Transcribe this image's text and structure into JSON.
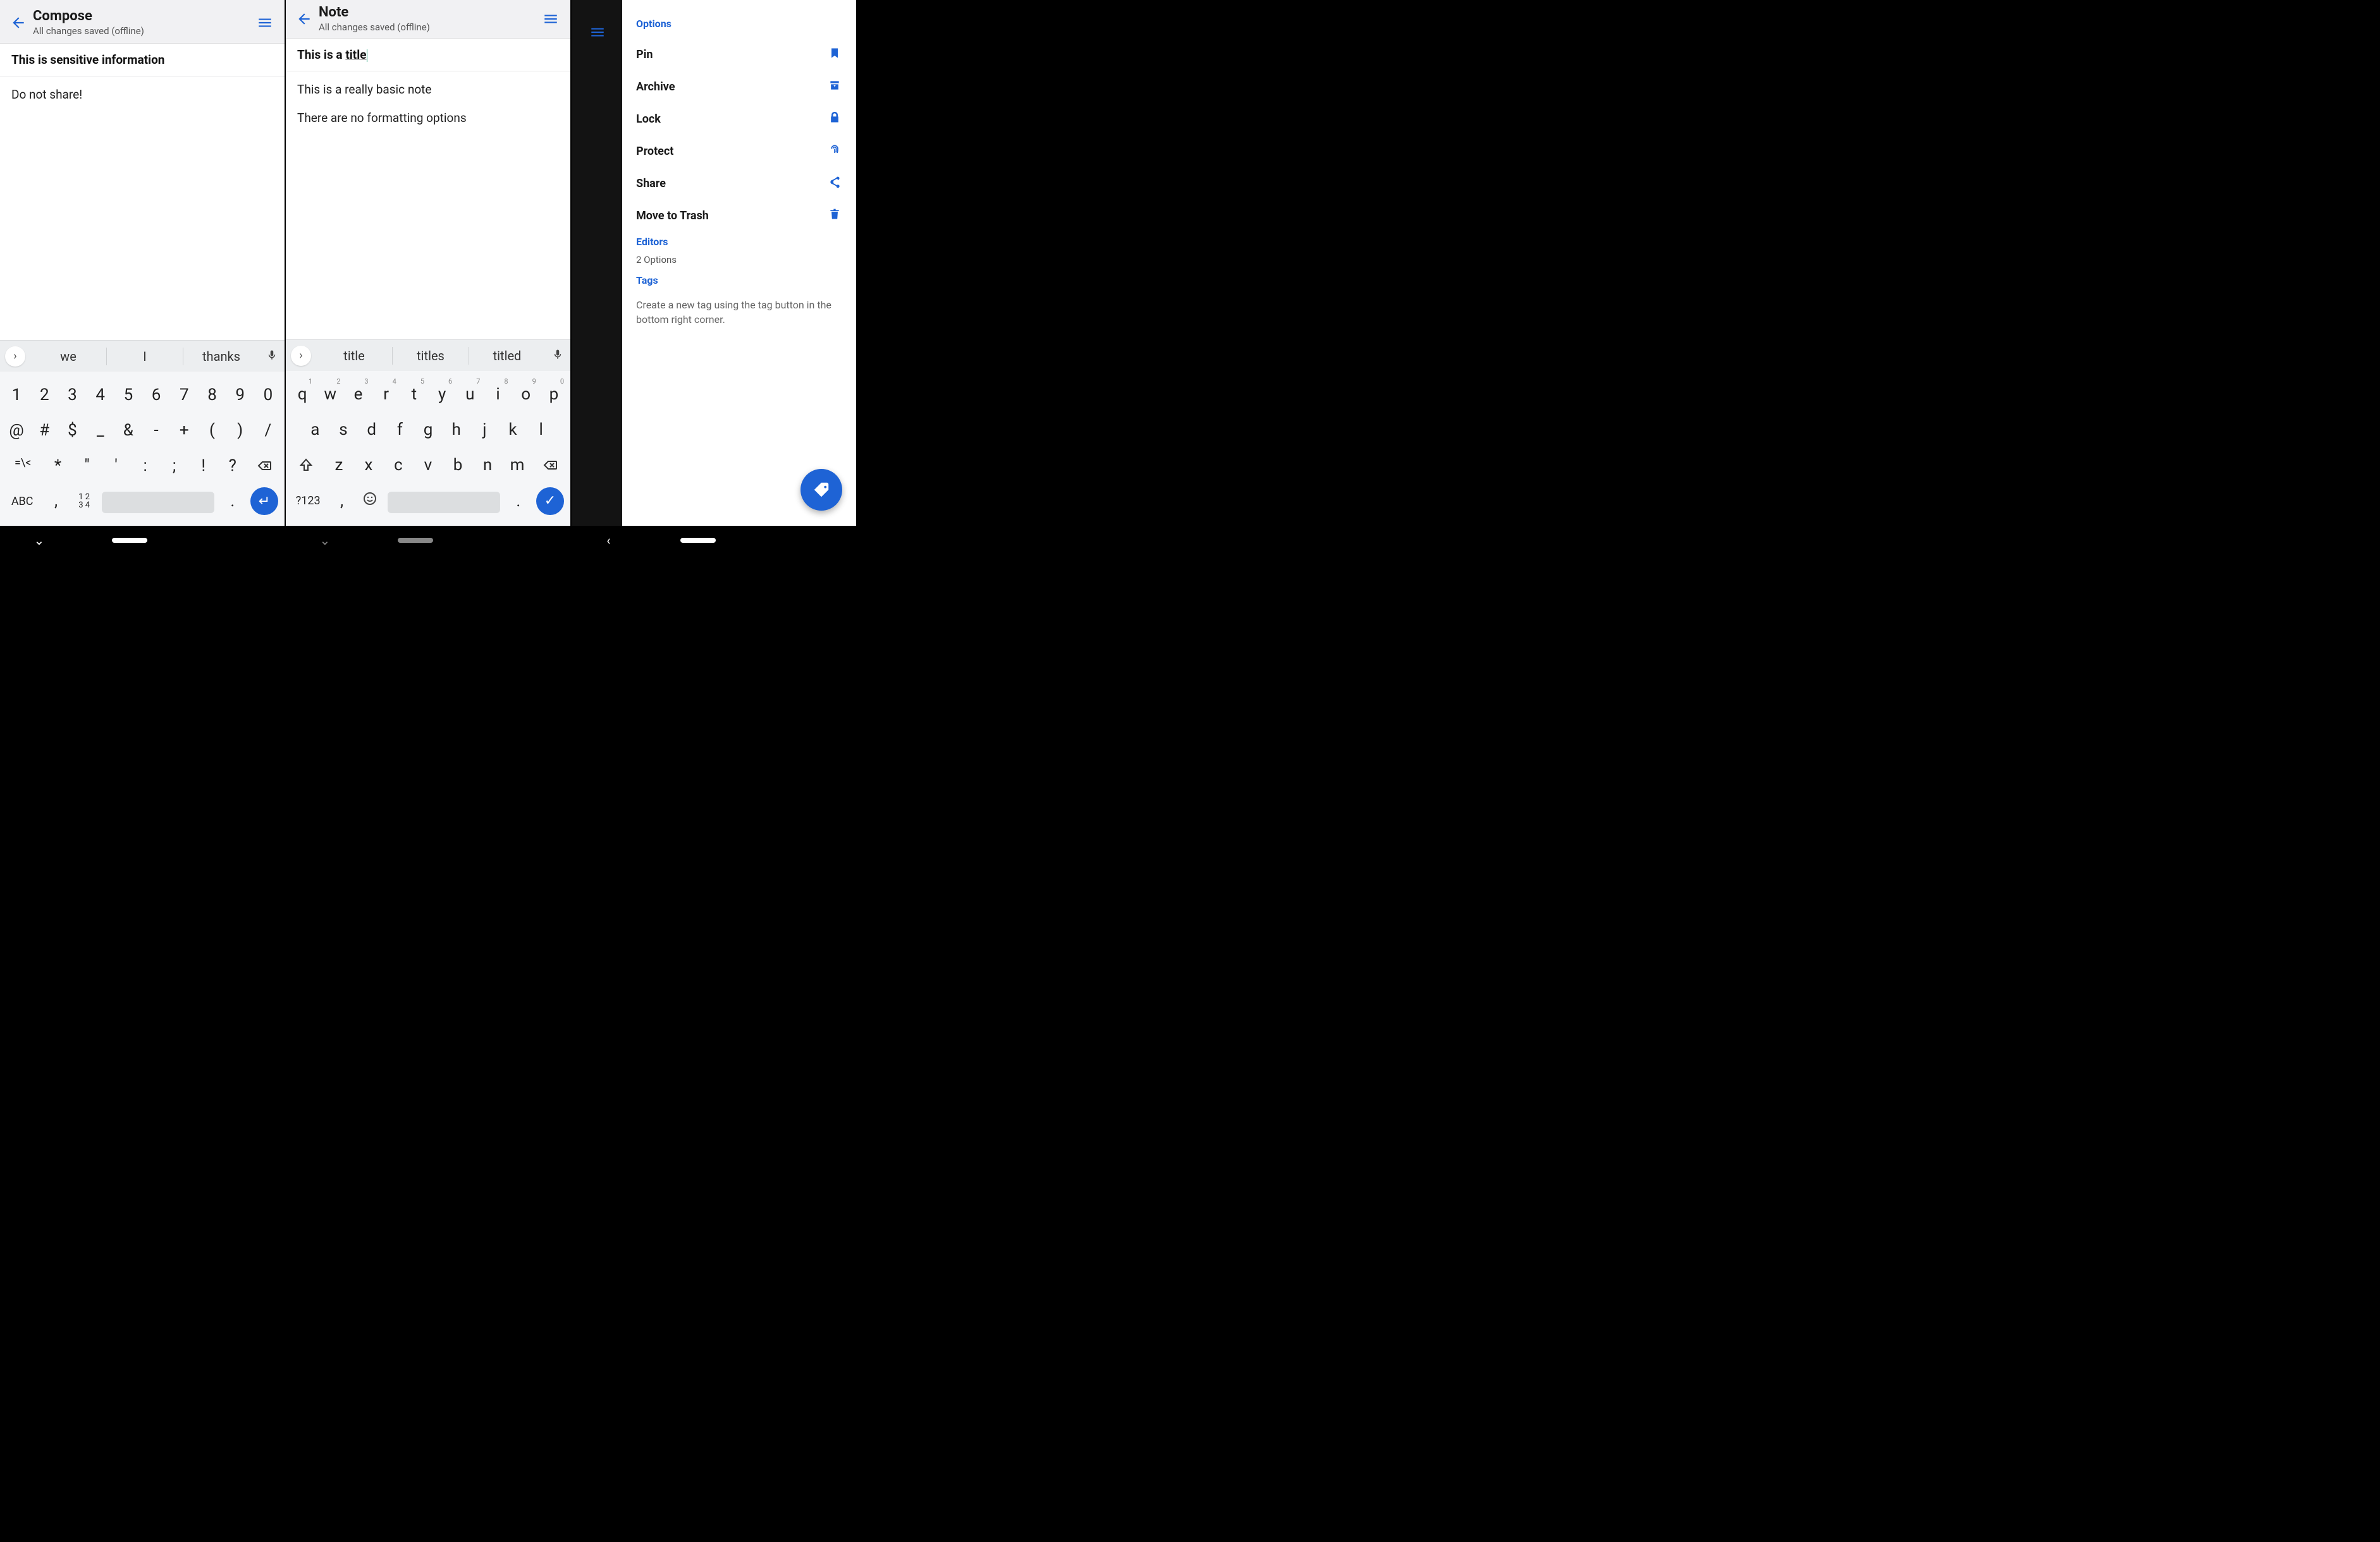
{
  "screen1": {
    "appbar": {
      "title": "Compose",
      "subtitle": "All changes saved (offline)"
    },
    "note_title": "This is sensitive information",
    "note_body": [
      "Do not share!"
    ],
    "suggestions": [
      "we",
      "I",
      "thanks"
    ],
    "keyboard": {
      "row1": [
        "1",
        "2",
        "3",
        "4",
        "5",
        "6",
        "7",
        "8",
        "9",
        "0"
      ],
      "row2": [
        "@",
        "#",
        "$",
        "_",
        "&",
        "-",
        "+",
        "(",
        ")",
        "/"
      ],
      "row3_left": "=\\<",
      "row3": [
        "*",
        "\"",
        "'",
        ":",
        ";",
        "!",
        "?"
      ],
      "row4_abc": "ABC",
      "row4_comma": ",",
      "row4_num": "1 2\n3 4",
      "row4_dot": "."
    }
  },
  "screen2": {
    "appbar": {
      "title": "Note",
      "subtitle": "All changes saved (offline)"
    },
    "note_title_prefix": "This is a ",
    "note_title_underlined": "title",
    "note_body": [
      "This is a really basic note",
      "There are no formatting options"
    ],
    "suggestions": [
      "title",
      "titles",
      "titled"
    ],
    "keyboard": {
      "row1": [
        {
          "k": "q",
          "n": "1"
        },
        {
          "k": "w",
          "n": "2"
        },
        {
          "k": "e",
          "n": "3"
        },
        {
          "k": "r",
          "n": "4"
        },
        {
          "k": "t",
          "n": "5"
        },
        {
          "k": "y",
          "n": "6"
        },
        {
          "k": "u",
          "n": "7"
        },
        {
          "k": "i",
          "n": "8"
        },
        {
          "k": "o",
          "n": "9"
        },
        {
          "k": "p",
          "n": "0"
        }
      ],
      "row2": [
        "a",
        "s",
        "d",
        "f",
        "g",
        "h",
        "j",
        "k",
        "l"
      ],
      "row3": [
        "z",
        "x",
        "c",
        "v",
        "b",
        "n",
        "m"
      ],
      "row4_sym": "?123",
      "row4_comma": ",",
      "row4_dot": "."
    }
  },
  "screen3": {
    "sections": {
      "options_label": "Options",
      "options": [
        "Pin",
        "Archive",
        "Lock",
        "Protect",
        "Share",
        "Move to Trash"
      ],
      "editors_label": "Editors",
      "editors_sub": "2 Options",
      "tags_label": "Tags",
      "tags_hint": "Create a new tag using the tag button in the bottom right corner."
    }
  }
}
